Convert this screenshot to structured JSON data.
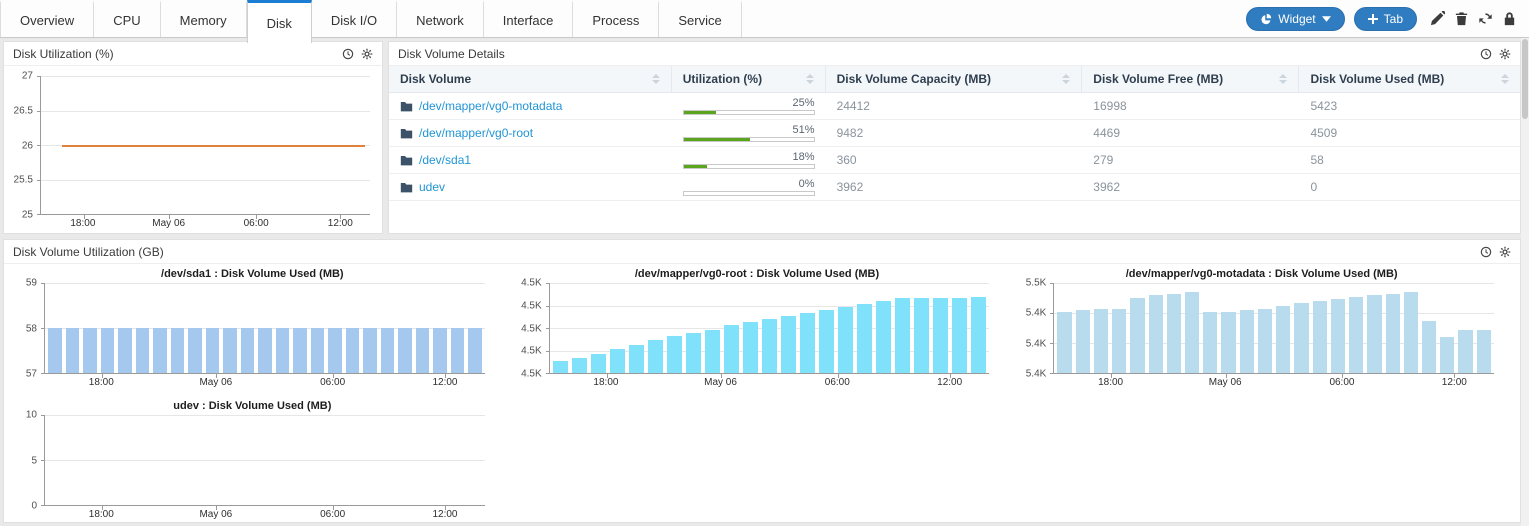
{
  "tabs": {
    "items": [
      {
        "label": "Overview",
        "active": false
      },
      {
        "label": "CPU",
        "active": false
      },
      {
        "label": "Memory",
        "active": false
      },
      {
        "label": "Disk",
        "active": true
      },
      {
        "label": "Disk I/O",
        "active": false
      },
      {
        "label": "Network",
        "active": false
      },
      {
        "label": "Interface",
        "active": false
      },
      {
        "label": "Process",
        "active": false
      },
      {
        "label": "Service",
        "active": false
      }
    ]
  },
  "toolbar": {
    "widget_button_label": "Widget",
    "tab_button_label": "Tab"
  },
  "panels": {
    "disk_utilization": {
      "title": "Disk Utilization (%)"
    },
    "disk_volume_details": {
      "title": "Disk Volume Details",
      "table": {
        "columns": [
          {
            "label": "Disk Volume",
            "width": "25.0%"
          },
          {
            "label": "Utilization (%)",
            "width": "13.6%"
          },
          {
            "label": "Disk Volume Capacity (MB)",
            "width": "22.7%"
          },
          {
            "label": "Disk Volume Free (MB)",
            "width": "19.2%"
          },
          {
            "label": "Disk Volume Used (MB)",
            "width": "19.5%"
          }
        ],
        "rows": [
          {
            "volume": "/dev/mapper/vg0-motadata",
            "utilization_label": "25%",
            "utilization_value": 25,
            "capacity_mb": "24412",
            "free_mb": "16998",
            "used_mb": "5423"
          },
          {
            "volume": "/dev/mapper/vg0-root",
            "utilization_label": "51%",
            "utilization_value": 51,
            "capacity_mb": "9482",
            "free_mb": "4469",
            "used_mb": "4509"
          },
          {
            "volume": "/dev/sda1",
            "utilization_label": "18%",
            "utilization_value": 18,
            "capacity_mb": "360",
            "free_mb": "279",
            "used_mb": "58"
          },
          {
            "volume": "udev",
            "utilization_label": "0%",
            "utilization_value": 0,
            "capacity_mb": "3962",
            "free_mb": "3962",
            "used_mb": "0"
          }
        ]
      }
    },
    "disk_volume_utilization": {
      "title": "Disk Volume Utilization (GB)"
    }
  },
  "chart_data": [
    {
      "id": "disk-utilization-line",
      "type": "line",
      "title": "",
      "ylim": [
        25,
        27
      ],
      "y_ticks": [
        "27",
        "26.5",
        "26",
        "25.5",
        "25"
      ],
      "x_labels": [
        "18:00",
        "May 06",
        "06:00",
        "12:00"
      ],
      "values": [
        26,
        26
      ],
      "color": "#e0823d",
      "grid": true,
      "legend": "none"
    },
    {
      "id": "sda1-used",
      "type": "bar",
      "title": "/dev/sda1 : Disk Volume Used (MB)",
      "ylim": [
        57,
        59
      ],
      "y_ticks": [
        "59",
        "58",
        "57"
      ],
      "x_labels": [
        "18:00",
        "May 06",
        "06:00",
        "12:00"
      ],
      "values": [
        58,
        58,
        58,
        58,
        58,
        58,
        58,
        58,
        58,
        58,
        58,
        58,
        58,
        58,
        58,
        58,
        58,
        58,
        58,
        58,
        58,
        58,
        58,
        58,
        58
      ],
      "color": "#a5c8ee",
      "grid": true
    },
    {
      "id": "vg0-root-used",
      "type": "bar",
      "title": "/dev/mapper/vg0-root : Disk Volume Used (MB)",
      "ylim": [
        4460,
        4520
      ],
      "y_ticks": [
        "4.5K",
        "4.5K",
        "4.5K",
        "4.5K",
        "4.5K"
      ],
      "x_labels": [
        "18:00",
        "May 06",
        "06:00",
        "12:00"
      ],
      "values": [
        4468,
        4470,
        4473,
        4476,
        4479,
        4482,
        4485,
        4487,
        4489,
        4492,
        4494,
        4496,
        4498,
        4500,
        4502,
        4504,
        4506,
        4508,
        4510,
        4510,
        4510,
        4510,
        4511
      ],
      "color": "#7fe1fa",
      "grid": true
    },
    {
      "id": "vg0-motadata-used",
      "type": "bar",
      "title": "/dev/mapper/vg0-motadata : Disk Volume Used (MB)",
      "ylim": [
        5360,
        5480
      ],
      "y_ticks": [
        "5.5K",
        "5.4K",
        "5.4K",
        "5.4K"
      ],
      "x_labels": [
        "18:00",
        "May 06",
        "06:00",
        "12:00"
      ],
      "values": [
        5442,
        5444,
        5446,
        5446,
        5460,
        5464,
        5466,
        5468,
        5442,
        5442,
        5444,
        5446,
        5450,
        5453,
        5456,
        5459,
        5462,
        5464,
        5466,
        5468,
        5430,
        5408,
        5418,
        5418
      ],
      "color": "#b8dbee",
      "grid": true
    },
    {
      "id": "udev-used",
      "type": "bar",
      "title": "udev : Disk Volume Used (MB)",
      "ylim": [
        0,
        10
      ],
      "y_ticks": [
        "10",
        "5",
        "0"
      ],
      "x_labels": [
        "18:00",
        "May 06",
        "06:00",
        "12:00"
      ],
      "values": [],
      "color": "#a5c8ee",
      "grid": true
    }
  ],
  "colors": {
    "accent_blue": "#2f7cc0",
    "active_tab_blue": "#1b7ed2",
    "link_blue": "#2095d5",
    "progress_green": "#5aa41e",
    "line_orange": "#e0823d",
    "bar_light_blue": "#a5c8ee",
    "bar_cyan": "#7fe1fa",
    "bar_powder_blue": "#b8dbee"
  }
}
